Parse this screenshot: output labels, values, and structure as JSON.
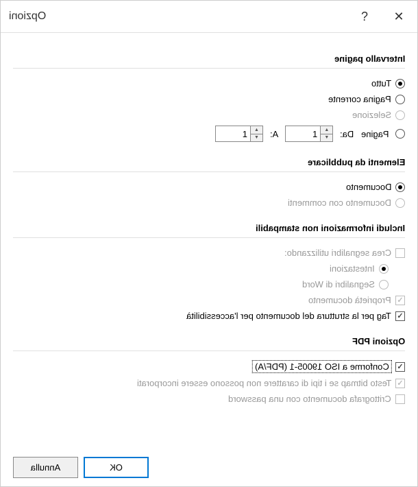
{
  "title": "Opzioni",
  "sections": {
    "page_range": {
      "header": "Intervallo pagine",
      "all": "Tutto",
      "current": "Pagina corrente",
      "selection": "Selezione",
      "pages": "Pagine",
      "from_label": "Da:",
      "to_label": "A:",
      "from_value": "1",
      "to_value": "1",
      "selected": "all",
      "selection_disabled": true
    },
    "publish": {
      "header": "Elementi da pubblicare",
      "document": "Documento",
      "with_comments": "Documento con commenti",
      "selected": "document",
      "comments_disabled": true
    },
    "nonprint": {
      "header": "Includi informazioni non stampabili",
      "create_bookmarks": "Crea segnalibri utilizzando:",
      "create_bookmarks_checked": false,
      "create_bookmarks_disabled": true,
      "headings": "Intestazioni",
      "headings_selected": true,
      "headings_disabled": true,
      "word_bookmarks": "Segnalibri di Word",
      "word_bookmarks_disabled": true,
      "doc_properties": "Proprietà documento",
      "doc_properties_checked": true,
      "doc_properties_disabled": true,
      "accessibility_tags": "Tag per la struttura del documento per l'accessibilità",
      "accessibility_tags_checked": true
    },
    "pdf_options": {
      "header": "Opzioni PDF",
      "iso_conform": "Conforme a ISO 19005-1 (PDF/A)",
      "iso_conform_checked": true,
      "iso_focused": true,
      "bitmap_text": "Testo bitmap se i tipi di carattere non possono essere incorporati",
      "bitmap_text_checked": true,
      "bitmap_text_disabled": true,
      "encrypt": "Crittografa documento con una password",
      "encrypt_checked": false,
      "encrypt_disabled": true
    }
  },
  "buttons": {
    "ok": "OK",
    "cancel": "Annulla"
  }
}
